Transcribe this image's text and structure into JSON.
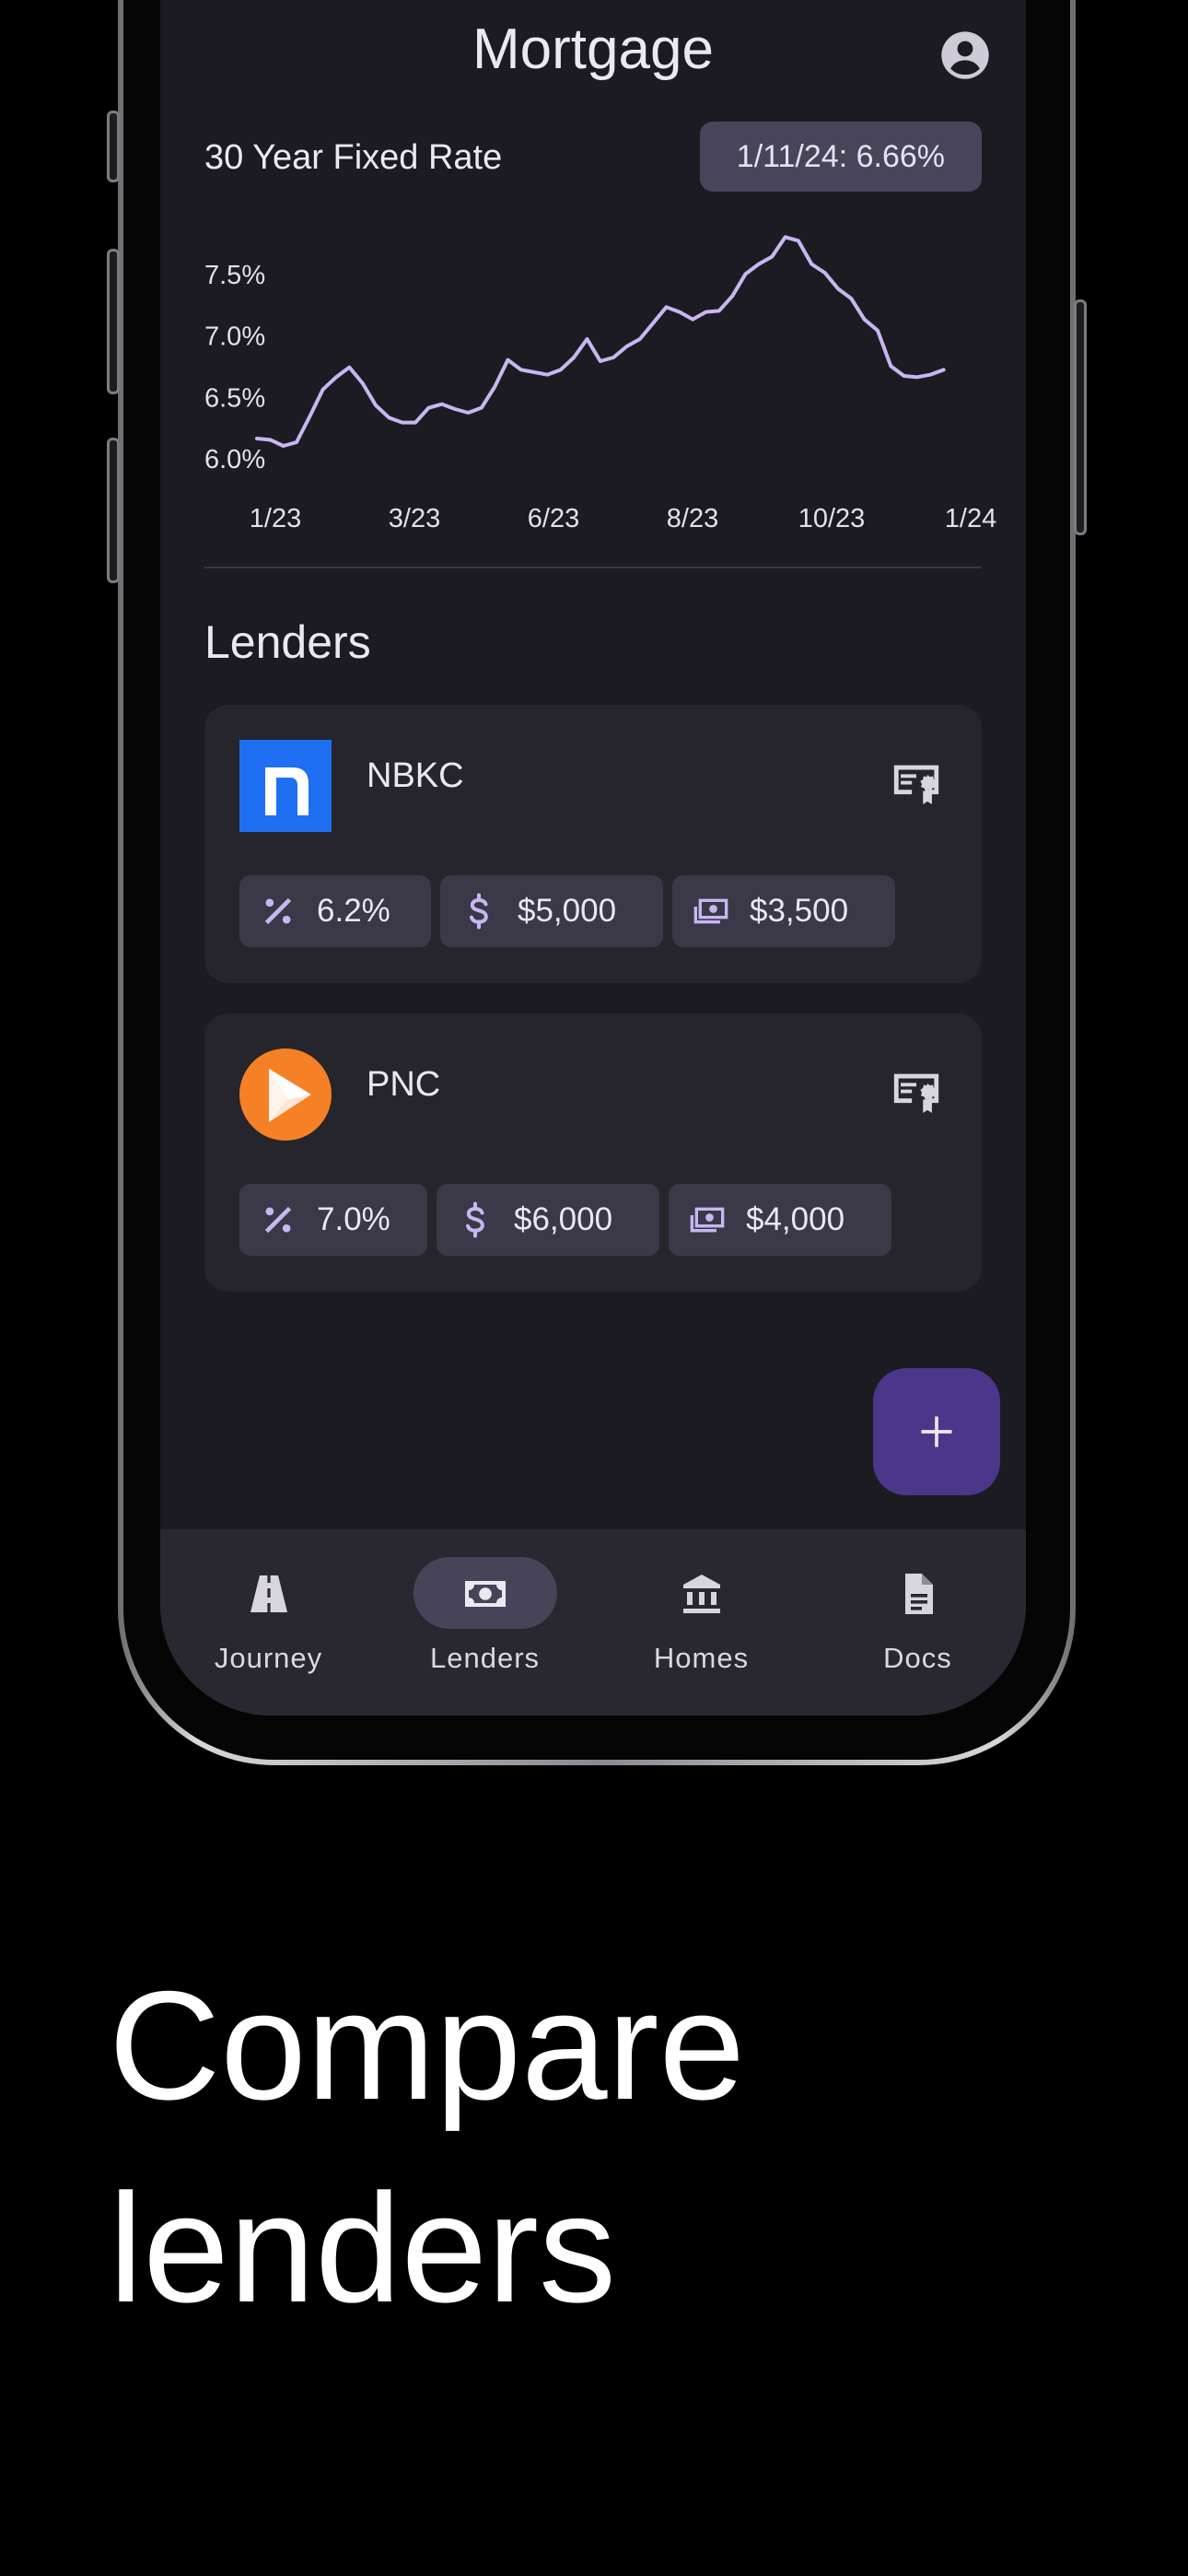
{
  "app": {
    "title": "Mortgage"
  },
  "rate": {
    "label": "30 Year Fixed Rate",
    "current_chip": "1/11/24: 6.66%"
  },
  "chart_data": {
    "type": "line",
    "title": "30 Year Fixed Rate",
    "x_ticks": [
      "1/23",
      "3/23",
      "6/23",
      "8/23",
      "10/23",
      "1/24"
    ],
    "y_ticks": [
      "6.0%",
      "6.5%",
      "7.0%",
      "7.5%"
    ],
    "ylim": [
      6.0,
      7.8
    ],
    "x_range": [
      0,
      53
    ],
    "series": [
      {
        "values": [
          6.15,
          6.14,
          6.09,
          6.12,
          6.33,
          6.55,
          6.65,
          6.73,
          6.6,
          6.42,
          6.32,
          6.28,
          6.28,
          6.4,
          6.43,
          6.39,
          6.36,
          6.4,
          6.57,
          6.79,
          6.71,
          6.69,
          6.67,
          6.71,
          6.81,
          6.96,
          6.78,
          6.81,
          6.9,
          6.96,
          7.09,
          7.22,
          7.18,
          7.12,
          7.18,
          7.19,
          7.31,
          7.49,
          7.57,
          7.63,
          7.79,
          7.76,
          7.57,
          7.5,
          7.37,
          7.29,
          7.12,
          7.03,
          6.74,
          6.66,
          6.65,
          6.67,
          6.71
        ],
        "color": "#c8b6f2"
      }
    ],
    "grid": false
  },
  "lenders": {
    "title": "Lenders",
    "items": [
      {
        "name": "NBKC",
        "rate": "6.2%",
        "fees": "$5,000",
        "cash": "$3,500"
      },
      {
        "name": "PNC",
        "rate": "7.0%",
        "fees": "$6,000",
        "cash": "$4,000"
      }
    ]
  },
  "fab": {
    "icon": "plus-icon"
  },
  "nav": {
    "items": [
      {
        "label": "Journey",
        "icon": "road-icon"
      },
      {
        "label": "Lenders",
        "icon": "money-icon",
        "active": true
      },
      {
        "label": "Homes",
        "icon": "bank-icon"
      },
      {
        "label": "Docs",
        "icon": "document-icon"
      }
    ]
  },
  "marketing": {
    "line1": "Compare",
    "line2": "lenders"
  },
  "colors": {
    "background": "#000000",
    "screen": "#1c1b21",
    "card": "#26252c",
    "chip": "#3b3947",
    "accent": "#c8b6f2",
    "fab": "#4b368a",
    "nbkc_blue": "#1f6ff2",
    "pnc_orange": "#f58025"
  }
}
